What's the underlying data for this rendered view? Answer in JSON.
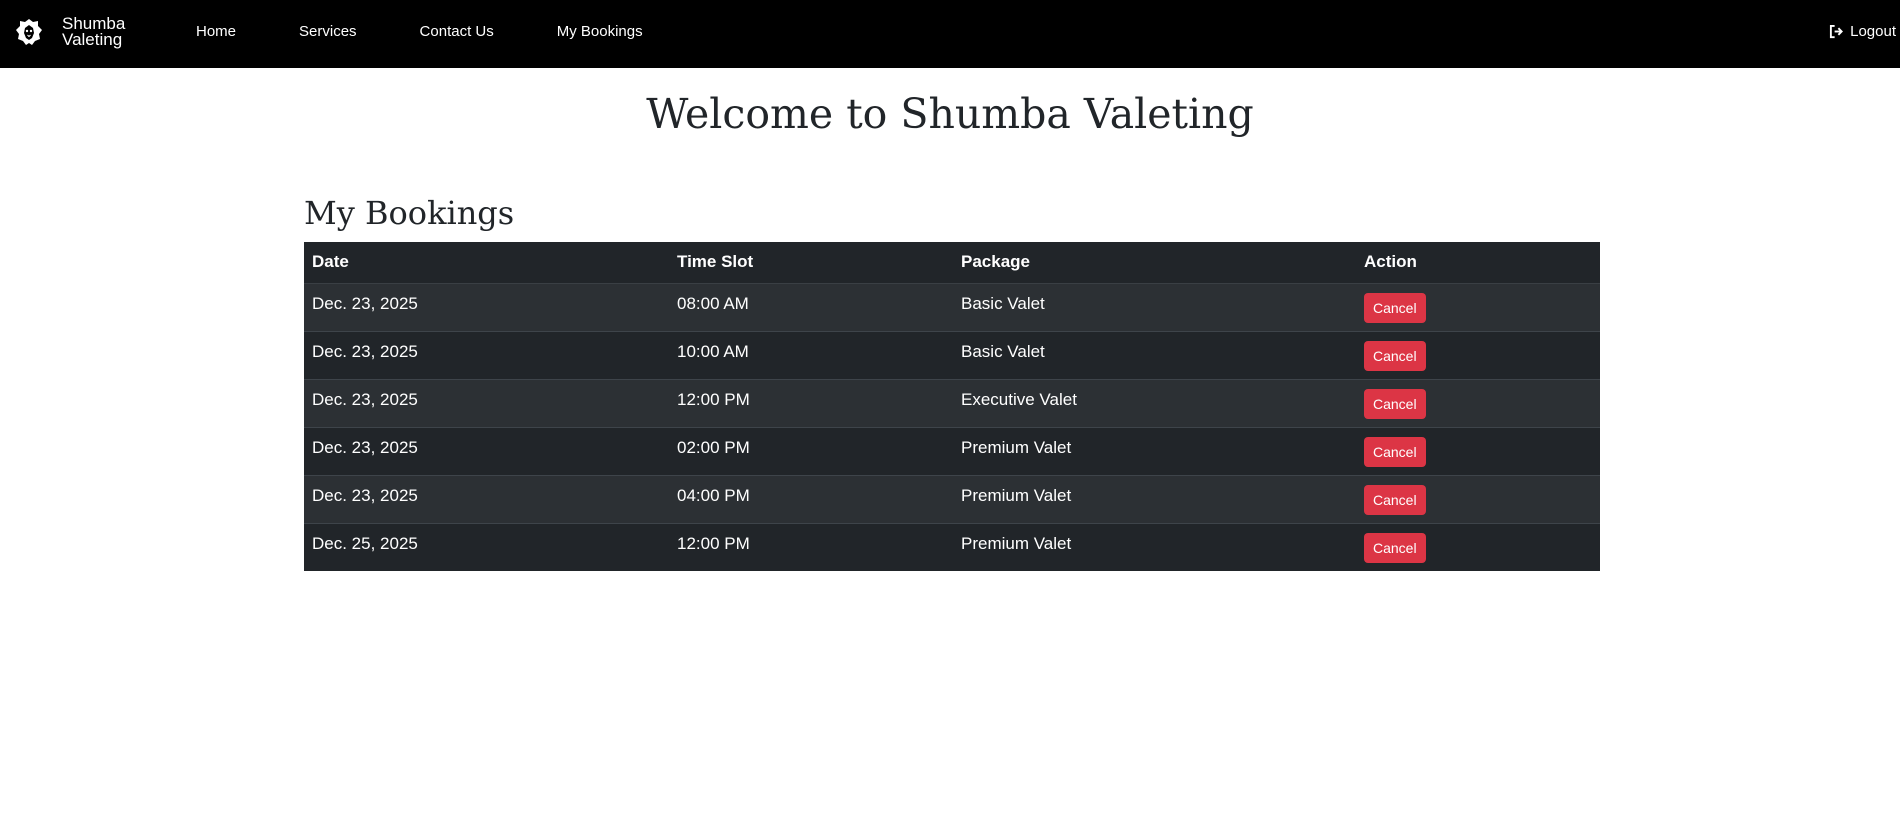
{
  "navbar": {
    "brand_line1": "Shumba",
    "brand_line2": "Valeting",
    "brand_icon": "lion-icon",
    "links": [
      {
        "label": "Home"
      },
      {
        "label": "Services"
      },
      {
        "label": "Contact Us"
      },
      {
        "label": "My Bookings"
      }
    ],
    "logout_label": "Logout",
    "logout_icon": "sign-out-icon"
  },
  "page": {
    "title": "Welcome to Shumba Valeting",
    "section_title": "My Bookings"
  },
  "bookings": {
    "columns": [
      "Date",
      "Time Slot",
      "Package",
      "Action"
    ],
    "rows": [
      {
        "date": "Dec. 23, 2025",
        "time": "08:00 AM",
        "package": "Basic Valet",
        "action": "Cancel"
      },
      {
        "date": "Dec. 23, 2025",
        "time": "10:00 AM",
        "package": "Basic Valet",
        "action": "Cancel"
      },
      {
        "date": "Dec. 23, 2025",
        "time": "12:00 PM",
        "package": "Executive Valet",
        "action": "Cancel"
      },
      {
        "date": "Dec. 23, 2025",
        "time": "02:00 PM",
        "package": "Premium Valet",
        "action": "Cancel"
      },
      {
        "date": "Dec. 23, 2025",
        "time": "04:00 PM",
        "package": "Premium Valet",
        "action": "Cancel"
      },
      {
        "date": "Dec. 25, 2025",
        "time": "12:00 PM",
        "package": "Premium Valet",
        "action": "Cancel"
      }
    ]
  },
  "colors": {
    "navbar_bg": "#000000",
    "table_dark": "#212529",
    "table_stripe": "#2c3034",
    "cancel_button": "#dc3545",
    "heading_text": "#212529"
  }
}
